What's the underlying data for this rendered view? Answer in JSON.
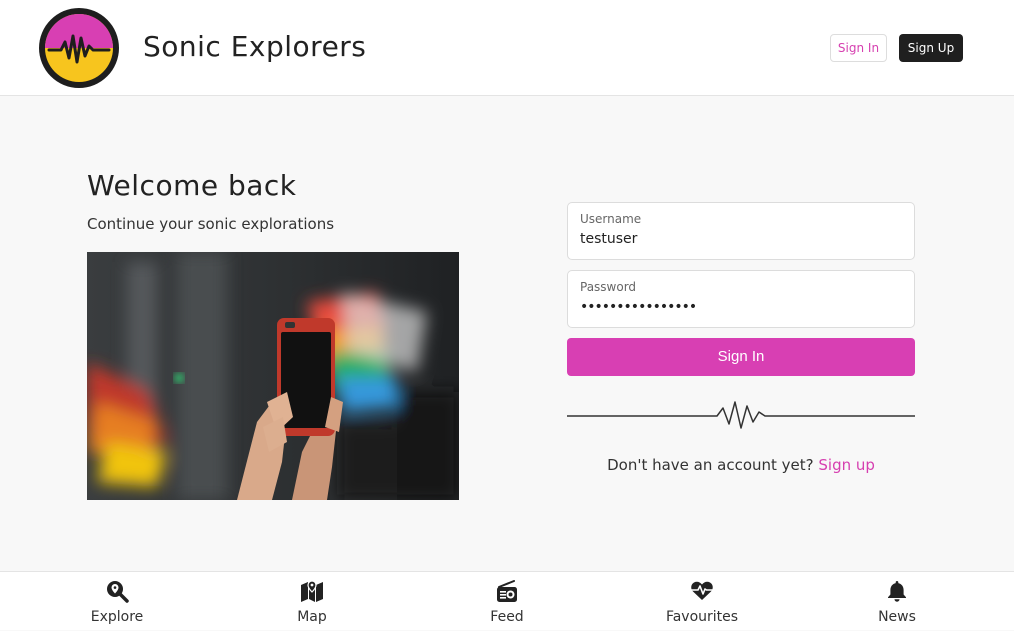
{
  "header": {
    "brand": "Sonic Explorers",
    "sign_in_label": "Sign In",
    "sign_up_label": "Sign Up"
  },
  "login": {
    "title": "Welcome back",
    "subtitle": "Continue your sonic explorations",
    "username": {
      "label": "Username",
      "value": "testuser"
    },
    "password": {
      "label": "Password",
      "value": "••••••••••••••••"
    },
    "submit_label": "Sign In",
    "no_account_text": "Don't have an account yet? ",
    "sign_up_link": "Sign up"
  },
  "bottom_nav": {
    "items": [
      {
        "label": "Explore",
        "icon": "search-location-icon"
      },
      {
        "label": "Map",
        "icon": "map-icon"
      },
      {
        "label": "Feed",
        "icon": "radio-icon"
      },
      {
        "label": "Favourites",
        "icon": "heartbeat-icon"
      },
      {
        "label": "News",
        "icon": "bell-icon"
      }
    ]
  },
  "colors": {
    "accent": "#d83fb3",
    "logo_yellow": "#f7c51e",
    "dark_button": "#1f1f1f"
  }
}
